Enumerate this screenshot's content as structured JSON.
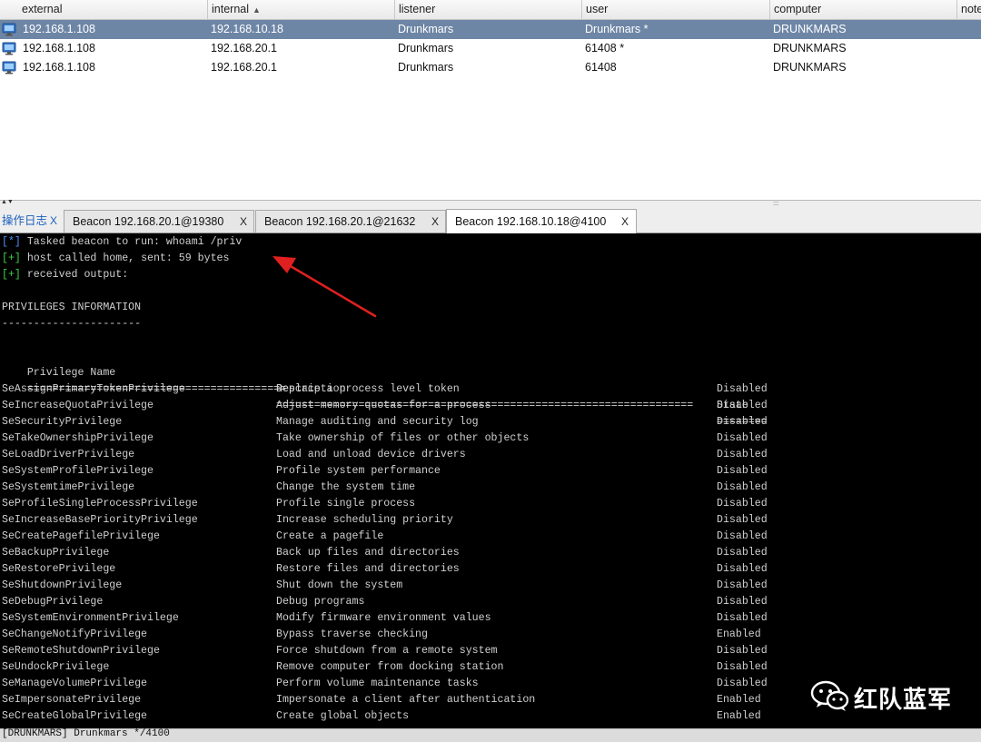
{
  "sessions": {
    "columns": [
      "external",
      "internal",
      "listener",
      "user",
      "computer",
      "note"
    ],
    "sorted_column": "internal",
    "sort_glyph": "▲",
    "rows": [
      {
        "external": "192.168.1.108",
        "internal": "192.168.10.18",
        "listener": "Drunkmars",
        "user": "Drunkmars *",
        "computer": "DRUNKMARS",
        "selected": true
      },
      {
        "external": "192.168.1.108",
        "internal": "192.168.20.1",
        "listener": "Drunkmars",
        "user": "61408 *",
        "computer": "DRUNKMARS",
        "selected": false
      },
      {
        "external": "192.168.1.108",
        "internal": "192.168.20.1",
        "listener": "Drunkmars",
        "user": "61408",
        "computer": "DRUNKMARS",
        "selected": false
      }
    ],
    "row_icon": "computer-monitor-icon"
  },
  "splitter": {
    "collapse_glyph": "▲▼",
    "grip_glyph": "::::::"
  },
  "tabs": [
    {
      "label": "操作日志",
      "close": "X",
      "active": false
    },
    {
      "label": "Beacon 192.168.20.1@19380",
      "close": "X",
      "active": false
    },
    {
      "label": "Beacon 192.168.20.1@21632",
      "close": "X",
      "active": false
    },
    {
      "label": "Beacon 192.168.10.18@4100",
      "close": "X",
      "active": true
    }
  ],
  "console": {
    "lines": [
      {
        "tag": "[*]",
        "text": " Tasked beacon to run: whoami /priv"
      },
      {
        "tag": "[+]",
        "text": " host called home, sent: 59 bytes"
      },
      {
        "tag": "[+]",
        "text": " received output:"
      }
    ],
    "section_title": "PRIVILEGES INFORMATION",
    "section_rule": "----------------------",
    "headers": [
      "Privilege Name",
      "Description",
      "State"
    ],
    "rules": [
      "=========================================",
      "==================================================================",
      "========"
    ],
    "privileges": [
      [
        "SeAssignPrimaryTokenPrivilege",
        "Replace a process level token",
        "Disabled"
      ],
      [
        "SeIncreaseQuotaPrivilege",
        "Adjust memory quotas for a process",
        "Disabled"
      ],
      [
        "SeSecurityPrivilege",
        "Manage auditing and security log",
        "Disabled"
      ],
      [
        "SeTakeOwnershipPrivilege",
        "Take ownership of files or other objects",
        "Disabled"
      ],
      [
        "SeLoadDriverPrivilege",
        "Load and unload device drivers",
        "Disabled"
      ],
      [
        "SeSystemProfilePrivilege",
        "Profile system performance",
        "Disabled"
      ],
      [
        "SeSystemtimePrivilege",
        "Change the system time",
        "Disabled"
      ],
      [
        "SeProfileSingleProcessPrivilege",
        "Profile single process",
        "Disabled"
      ],
      [
        "SeIncreaseBasePriorityPrivilege",
        "Increase scheduling priority",
        "Disabled"
      ],
      [
        "SeCreatePagefilePrivilege",
        "Create a pagefile",
        "Disabled"
      ],
      [
        "SeBackupPrivilege",
        "Back up files and directories",
        "Disabled"
      ],
      [
        "SeRestorePrivilege",
        "Restore files and directories",
        "Disabled"
      ],
      [
        "SeShutdownPrivilege",
        "Shut down the system",
        "Disabled"
      ],
      [
        "SeDebugPrivilege",
        "Debug programs",
        "Disabled"
      ],
      [
        "SeSystemEnvironmentPrivilege",
        "Modify firmware environment values",
        "Disabled"
      ],
      [
        "SeChangeNotifyPrivilege",
        "Bypass traverse checking",
        "Enabled"
      ],
      [
        "SeRemoteShutdownPrivilege",
        "Force shutdown from a remote system",
        "Disabled"
      ],
      [
        "SeUndockPrivilege",
        "Remove computer from docking station",
        "Disabled"
      ],
      [
        "SeManageVolumePrivilege",
        "Perform volume maintenance tasks",
        "Disabled"
      ],
      [
        "SeImpersonatePrivilege",
        "Impersonate a client after authentication",
        "Enabled"
      ],
      [
        "SeCreateGlobalPrivilege",
        "Create global objects",
        "Enabled"
      ]
    ]
  },
  "status_bar": {
    "text": "[DRUNKMARS] Drunkmars */4100"
  },
  "watermark": {
    "text": "红队蓝军",
    "icon": "wechat-logo-icon"
  },
  "colors": {
    "selected_row": "#6e86a6",
    "tag_info": "#4f8fff",
    "tag_ok": "#3fd24a",
    "annotation_arrow": "#e02020",
    "console_bg": "#000000"
  }
}
